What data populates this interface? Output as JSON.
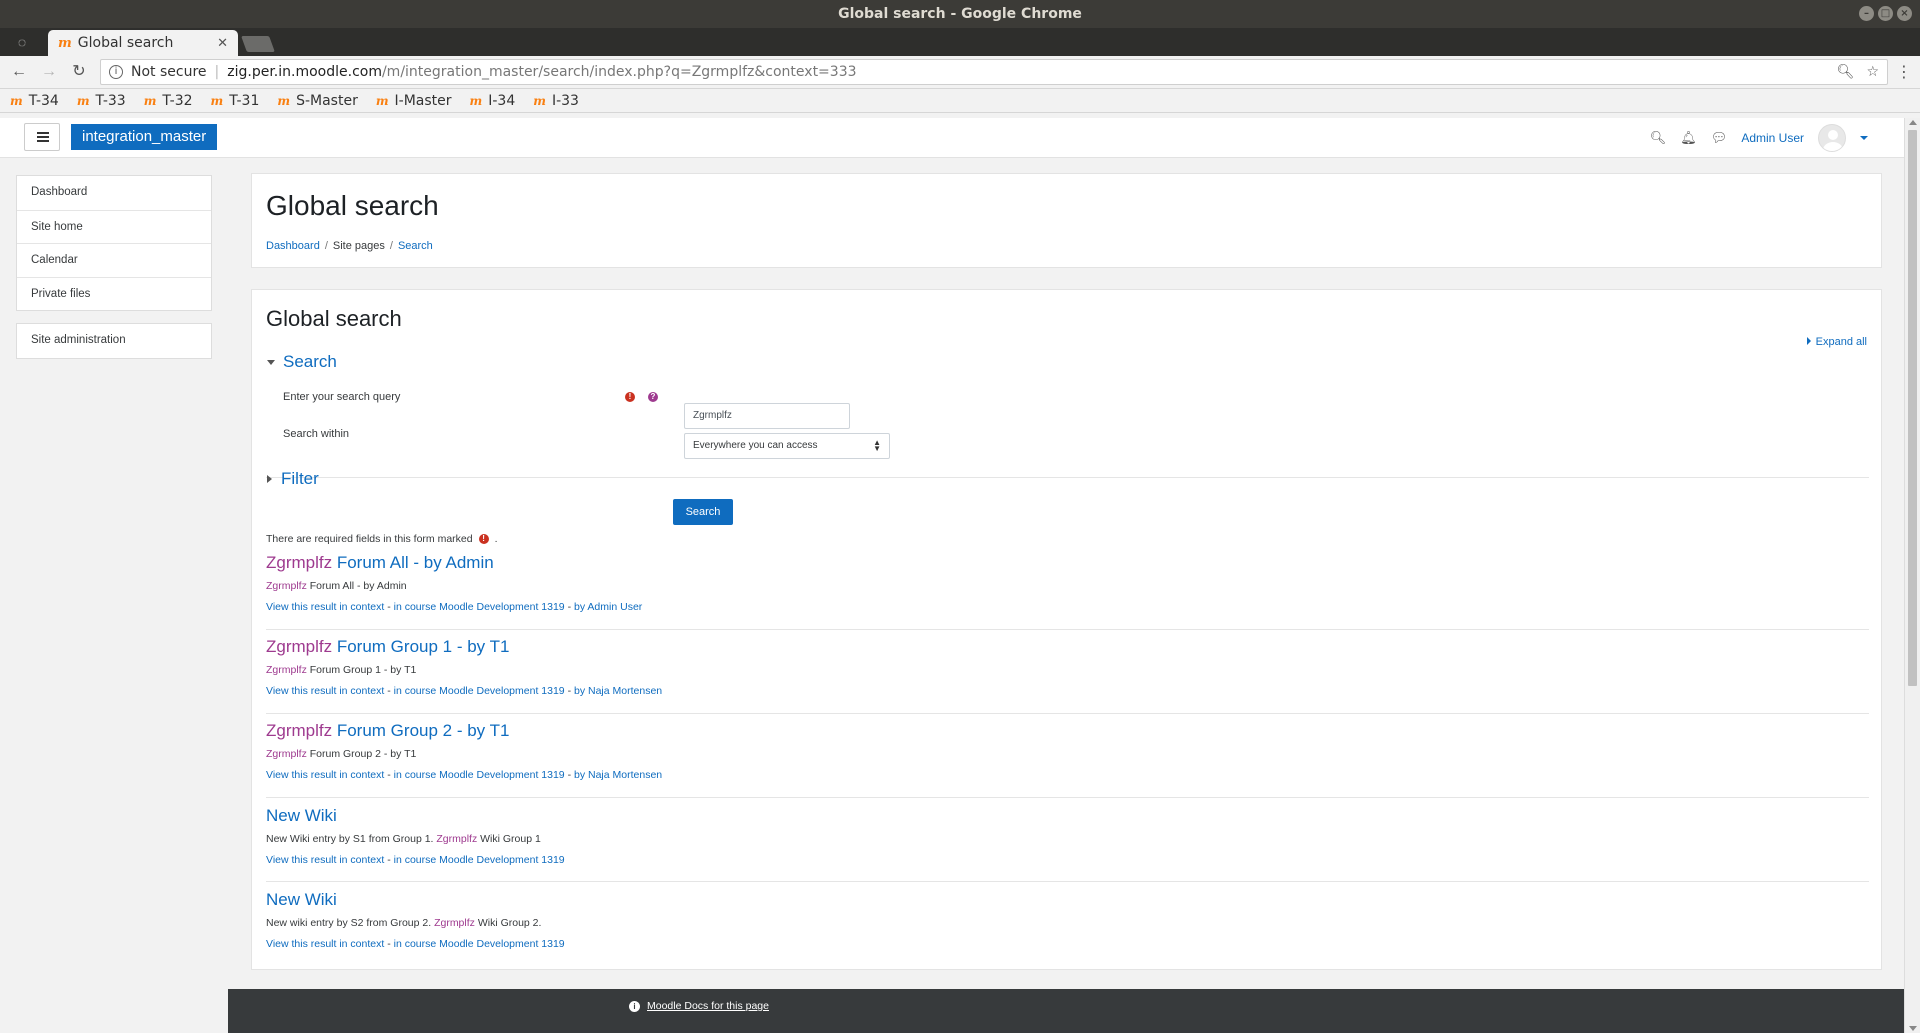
{
  "window": {
    "title": "Global search - Google Chrome"
  },
  "tab": {
    "label": "Global search",
    "favicon": "moodle-m"
  },
  "omnibox": {
    "security": "Not secure",
    "host": "zig.per.in.moodle.com",
    "path": "/m/integration_master/search/index.php?q=Zgrmplfz&context=333"
  },
  "bookmarks": [
    "T-34",
    "T-33",
    "T-32",
    "T-31",
    "S-Master",
    "I-Master",
    "I-34",
    "I-33"
  ],
  "navbar": {
    "brand": "integration_master",
    "user": "Admin User"
  },
  "sidebar": {
    "items": [
      "Dashboard",
      "Site home",
      "Calendar",
      "Private files"
    ],
    "admin": "Site administration"
  },
  "header": {
    "title": "Global search",
    "breadcrumb": [
      "Dashboard",
      "Site pages",
      "Search"
    ]
  },
  "form": {
    "heading": "Global search",
    "expand_all": "Expand all",
    "search_section": "Search",
    "query_label": "Enter your search query",
    "query_value": "Zgrmplfz",
    "within_label": "Search within",
    "within_value": "Everywhere you can access",
    "filter_section": "Filter",
    "submit": "Search",
    "required_note": "There are required fields in this form marked",
    "required_note_end": "."
  },
  "results": [
    {
      "title_hl": "Zgrmplfz",
      "title_rest": " Forum All - by Admin",
      "desc_pre": "",
      "desc_hl": "Zgrmplfz",
      "desc_post": " Forum All - by Admin",
      "context": "View this result in context",
      "course": "in course Moodle Development 1319",
      "author": "by Admin User"
    },
    {
      "title_hl": "Zgrmplfz",
      "title_rest": " Forum Group 1 - by T1",
      "desc_pre": "",
      "desc_hl": "Zgrmplfz",
      "desc_post": " Forum Group 1 - by T1",
      "context": "View this result in context",
      "course": "in course Moodle Development 1319",
      "author": "by Naja Mortensen"
    },
    {
      "title_hl": "Zgrmplfz",
      "title_rest": " Forum Group 2 - by T1",
      "desc_pre": "",
      "desc_hl": "Zgrmplfz",
      "desc_post": " Forum Group 2 - by T1",
      "context": "View this result in context",
      "course": "in course Moodle Development 1319",
      "author": "by Naja Mortensen"
    },
    {
      "title_hl": "",
      "title_rest": "New Wiki",
      "desc_pre": "New Wiki entry by S1 from Group 1. ",
      "desc_hl": "Zgrmplfz",
      "desc_post": " Wiki Group 1",
      "context": "View this result in context",
      "course": "in course Moodle Development 1319",
      "author": ""
    },
    {
      "title_hl": "",
      "title_rest": "New Wiki",
      "desc_pre": "New wiki entry by S2 from Group 2. ",
      "desc_hl": "Zgrmplfz",
      "desc_post": " Wiki Group 2.",
      "context": "View this result in context",
      "course": "in course Moodle Development 1319",
      "author": ""
    }
  ],
  "footer": {
    "docs_link": "Moodle Docs for this page"
  },
  "colors": {
    "brand": "#0f6cbf",
    "highlight": "#9e3a8f",
    "required": "#ca3120"
  }
}
